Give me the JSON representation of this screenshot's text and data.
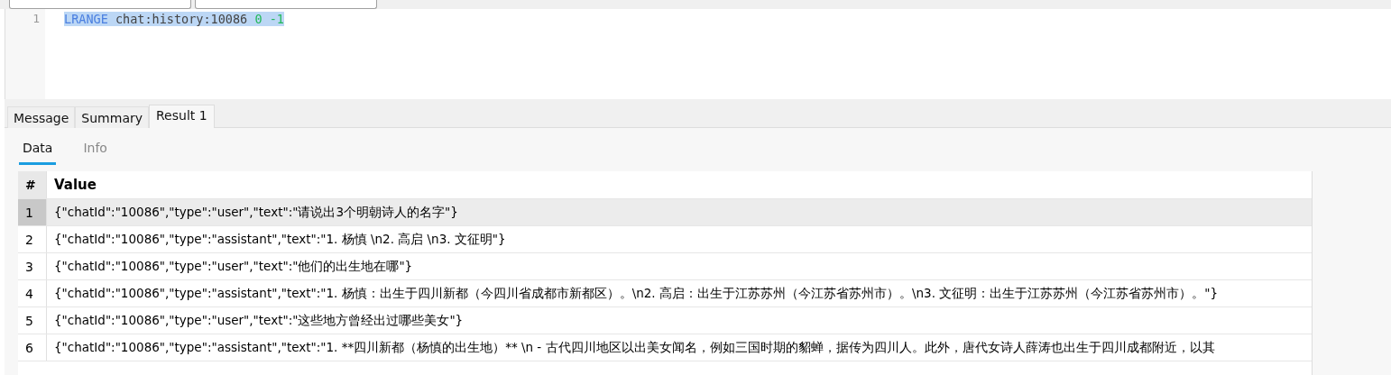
{
  "toolbar": {
    "fields": [
      {
        "kind": "dropdown"
      },
      {
        "kind": "dropdown"
      }
    ]
  },
  "editor": {
    "lines": [
      {
        "number": "1",
        "selected": true,
        "tokens": [
          {
            "kind": "keyword",
            "text": "LRANGE"
          },
          {
            "kind": "plain",
            "text": "chat:history:10086"
          },
          {
            "kind": "number",
            "text": "0"
          },
          {
            "kind": "number",
            "text": "-1"
          }
        ]
      }
    ]
  },
  "tabs": [
    {
      "label": "Message",
      "selected": false
    },
    {
      "label": "Summary",
      "selected": false
    },
    {
      "label": "Result 1",
      "selected": true
    }
  ],
  "subtabs": [
    {
      "label": "Data",
      "selected": true
    },
    {
      "label": "Info",
      "selected": false
    }
  ],
  "table": {
    "columns": [
      "#",
      "Value"
    ],
    "rows": [
      {
        "index": "1",
        "selected": true,
        "value": "{\"chatId\":\"10086\",\"type\":\"user\",\"text\":\"请说出3个明朝诗人的名字\"}"
      },
      {
        "index": "2",
        "selected": false,
        "value": "{\"chatId\":\"10086\",\"type\":\"assistant\",\"text\":\"1. 杨慎  \\n2. 高启  \\n3. 文征明\"}"
      },
      {
        "index": "3",
        "selected": false,
        "value": "{\"chatId\":\"10086\",\"type\":\"user\",\"text\":\"他们的出生地在哪\"}"
      },
      {
        "index": "4",
        "selected": false,
        "value": "{\"chatId\":\"10086\",\"type\":\"assistant\",\"text\":\"1. 杨慎：出生于四川新都（今四川省成都市新都区）。\\n2. 高启：出生于江苏苏州（今江苏省苏州市）。\\n3. 文征明：出生于江苏苏州（今江苏省苏州市）。\"}"
      },
      {
        "index": "5",
        "selected": false,
        "value": "{\"chatId\":\"10086\",\"type\":\"user\",\"text\":\"这些地方曾经出过哪些美女\"}"
      },
      {
        "index": "6",
        "selected": false,
        "value": "{\"chatId\":\"10086\",\"type\":\"assistant\",\"text\":\"1. **四川新都（杨慎的出生地）**  \\n  - 古代四川地区以出美女闻名，例如三国时期的貂蝉，据传为四川人。此外，唐代女诗人薛涛也出生于四川成都附近，以其"
      }
    ]
  }
}
